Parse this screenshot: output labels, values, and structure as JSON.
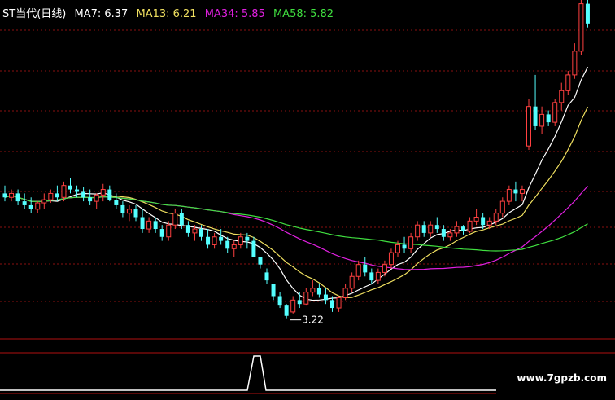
{
  "header": {
    "stock_name": "ST当代(日线)",
    "ma_items": [
      {
        "label": "MA7: 6.37",
        "color": "#ffffff"
      },
      {
        "label": "MA13: 6.21",
        "color": "#f0e060"
      },
      {
        "label": "MA34: 5.85",
        "color": "#e020e0"
      },
      {
        "label": "MA58: 5.82",
        "color": "#40e040"
      }
    ]
  },
  "low_annotation": "3.22",
  "watermark": "www.7gpzb.com",
  "colors": {
    "up": "#ff4040",
    "down": "#54ffff",
    "grid": "#8a1010",
    "ma7": "#ffffff",
    "ma13": "#f0e060",
    "ma34": "#e020e0",
    "ma58": "#40e040"
  },
  "chart_data": {
    "type": "candlestick",
    "y_range": [
      3.0,
      7.0
    ],
    "candles": [
      [
        4.8,
        4.9,
        4.7,
        4.75
      ],
      [
        4.75,
        4.85,
        4.7,
        4.8
      ],
      [
        4.8,
        4.85,
        4.65,
        4.7
      ],
      [
        4.7,
        4.8,
        4.6,
        4.65
      ],
      [
        4.65,
        4.75,
        4.55,
        4.6
      ],
      [
        4.6,
        4.7,
        4.55,
        4.68
      ],
      [
        4.68,
        4.8,
        4.6,
        4.72
      ],
      [
        4.72,
        4.85,
        4.68,
        4.8
      ],
      [
        4.8,
        4.9,
        4.7,
        4.75
      ],
      [
        4.75,
        4.95,
        4.7,
        4.9
      ],
      [
        4.9,
        5.0,
        4.8,
        4.85
      ],
      [
        4.85,
        4.9,
        4.75,
        4.82
      ],
      [
        4.82,
        4.88,
        4.7,
        4.75
      ],
      [
        4.75,
        4.85,
        4.65,
        4.7
      ],
      [
        4.7,
        4.8,
        4.6,
        4.78
      ],
      [
        4.78,
        4.92,
        4.7,
        4.85
      ],
      [
        4.85,
        4.9,
        4.7,
        4.72
      ],
      [
        4.72,
        4.8,
        4.6,
        4.65
      ],
      [
        4.65,
        4.7,
        4.5,
        4.55
      ],
      [
        4.55,
        4.65,
        4.45,
        4.6
      ],
      [
        4.6,
        4.65,
        4.45,
        4.5
      ],
      [
        4.5,
        4.6,
        4.3,
        4.35
      ],
      [
        4.35,
        4.5,
        4.3,
        4.45
      ],
      [
        4.45,
        4.5,
        4.3,
        4.35
      ],
      [
        4.35,
        4.4,
        4.2,
        4.25
      ],
      [
        4.25,
        4.45,
        4.2,
        4.4
      ],
      [
        4.4,
        4.6,
        4.35,
        4.55
      ],
      [
        4.55,
        4.6,
        4.35,
        4.4
      ],
      [
        4.4,
        4.45,
        4.25,
        4.3
      ],
      [
        4.3,
        4.4,
        4.2,
        4.35
      ],
      [
        4.35,
        4.4,
        4.2,
        4.25
      ],
      [
        4.25,
        4.35,
        4.1,
        4.15
      ],
      [
        4.15,
        4.3,
        4.1,
        4.25
      ],
      [
        4.25,
        4.35,
        4.15,
        4.2
      ],
      [
        4.2,
        4.25,
        4.05,
        4.1
      ],
      [
        4.1,
        4.2,
        4.0,
        4.15
      ],
      [
        4.15,
        4.3,
        4.1,
        4.25
      ],
      [
        4.25,
        4.3,
        4.1,
        4.2
      ],
      [
        4.2,
        4.25,
        4.0,
        4.0
      ],
      [
        4.0,
        4.0,
        3.85,
        3.9
      ],
      [
        3.8,
        3.85,
        3.65,
        3.7
      ],
      [
        3.65,
        3.65,
        3.45,
        3.5
      ],
      [
        3.5,
        3.55,
        3.35,
        3.38
      ],
      [
        3.38,
        3.4,
        3.22,
        3.25
      ],
      [
        3.3,
        3.5,
        3.28,
        3.45
      ],
      [
        3.45,
        3.55,
        3.35,
        3.4
      ],
      [
        3.4,
        3.6,
        3.38,
        3.55
      ],
      [
        3.55,
        3.7,
        3.5,
        3.6
      ],
      [
        3.6,
        3.65,
        3.48,
        3.52
      ],
      [
        3.52,
        3.6,
        3.4,
        3.45
      ],
      [
        3.45,
        3.5,
        3.3,
        3.35
      ],
      [
        3.35,
        3.5,
        3.3,
        3.48
      ],
      [
        3.48,
        3.65,
        3.45,
        3.6
      ],
      [
        3.6,
        3.8,
        3.55,
        3.75
      ],
      [
        3.75,
        3.95,
        3.7,
        3.9
      ],
      [
        3.9,
        4.0,
        3.75,
        3.8
      ],
      [
        3.8,
        3.85,
        3.65,
        3.7
      ],
      [
        3.7,
        3.85,
        3.65,
        3.8
      ],
      [
        3.8,
        3.95,
        3.75,
        3.9
      ],
      [
        3.9,
        4.1,
        3.85,
        4.05
      ],
      [
        4.05,
        4.2,
        4.0,
        4.15
      ],
      [
        4.15,
        4.25,
        4.05,
        4.1
      ],
      [
        4.1,
        4.3,
        4.05,
        4.25
      ],
      [
        4.25,
        4.45,
        4.2,
        4.4
      ],
      [
        4.4,
        4.45,
        4.25,
        4.3
      ],
      [
        4.3,
        4.45,
        4.25,
        4.4
      ],
      [
        4.4,
        4.5,
        4.3,
        4.35
      ],
      [
        4.35,
        4.4,
        4.2,
        4.25
      ],
      [
        4.25,
        4.35,
        4.2,
        4.3
      ],
      [
        4.3,
        4.45,
        4.25,
        4.38
      ],
      [
        4.38,
        4.4,
        4.28,
        4.32
      ],
      [
        4.32,
        4.5,
        4.3,
        4.45
      ],
      [
        4.45,
        4.6,
        4.4,
        4.5
      ],
      [
        4.5,
        4.55,
        4.35,
        4.4
      ],
      [
        4.4,
        4.5,
        4.35,
        4.45
      ],
      [
        4.45,
        4.6,
        4.4,
        4.55
      ],
      [
        4.55,
        4.75,
        4.5,
        4.7
      ],
      [
        4.7,
        4.9,
        4.65,
        4.85
      ],
      [
        4.85,
        4.95,
        4.7,
        4.8
      ],
      [
        4.8,
        4.9,
        4.7,
        4.85
      ],
      [
        5.4,
        6.0,
        5.35,
        5.9
      ],
      [
        5.9,
        6.3,
        5.6,
        5.65
      ],
      [
        5.65,
        5.9,
        5.55,
        5.8
      ],
      [
        5.8,
        5.85,
        5.65,
        5.7
      ],
      [
        5.7,
        6.0,
        5.65,
        5.95
      ],
      [
        5.95,
        6.2,
        5.85,
        6.1
      ],
      [
        6.1,
        6.35,
        6.05,
        6.3
      ],
      [
        6.3,
        6.7,
        6.25,
        6.6
      ],
      [
        6.6,
        7.3,
        6.55,
        7.2
      ],
      [
        7.2,
        7.4,
        6.9,
        6.95
      ]
    ]
  }
}
